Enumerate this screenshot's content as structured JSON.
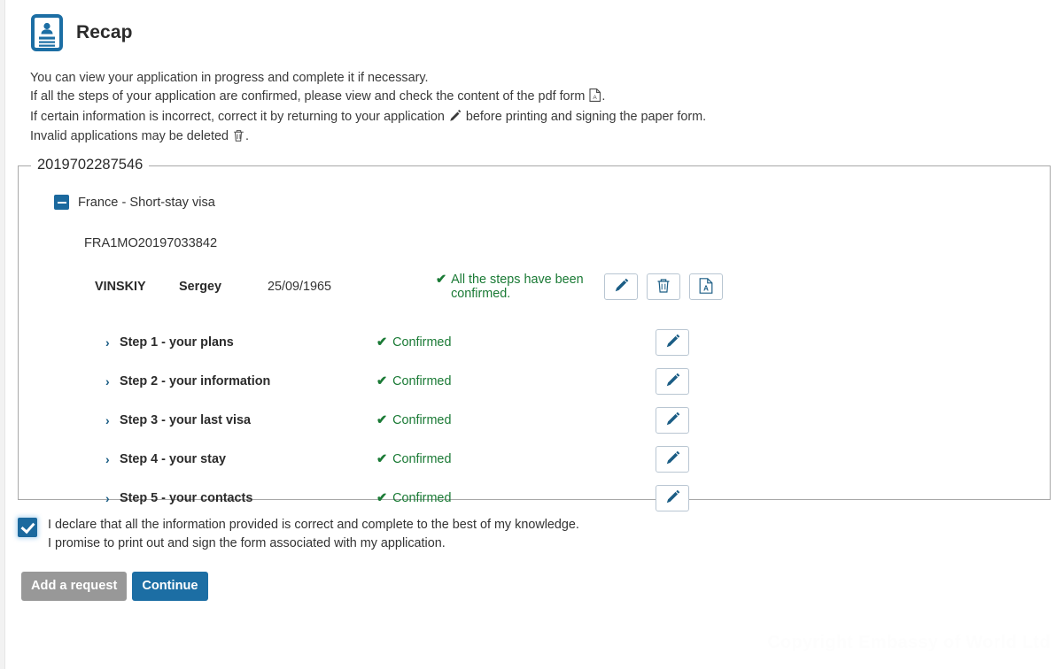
{
  "header": {
    "title": "Recap",
    "icon": "id-card-icon"
  },
  "intro": {
    "line1": "You can view your application in progress and complete it if necessary.",
    "line2_before": "If all the steps of your application are confirmed, please view and check the content of the pdf form",
    "line2_icon": "pdf-icon",
    "line2_after": ".",
    "line3_before": "If certain information is incorrect, correct it by returning to your application",
    "line3_icon": "pencil-icon",
    "line3_after": "before printing and signing the paper form.",
    "line4_before": "Invalid applications may be deleted",
    "line4_icon": "trash-icon",
    "line4_after": "."
  },
  "application": {
    "legend": "2019702287546",
    "toggle_icon": "minus-square-icon",
    "visa_label": "France - Short-stay visa",
    "reference": "FRA1MO20197033842",
    "applicant": {
      "surname": "VINSKIY",
      "firstname": "Sergey",
      "date_of_birth": "25/09/1965",
      "status": "All the steps have been confirmed.",
      "status_check": "✔",
      "actions": [
        {
          "name": "edit-application-button",
          "icon": "pencil-icon"
        },
        {
          "name": "delete-application-button",
          "icon": "trash-icon"
        },
        {
          "name": "download-pdf-button",
          "icon": "pdf-icon"
        }
      ]
    },
    "steps": [
      {
        "label": "Step 1 - your plans",
        "status": "Confirmed",
        "check": "✔",
        "chevron": "›",
        "edit_icon": "pencil-icon"
      },
      {
        "label": "Step 2 - your information",
        "status": "Confirmed",
        "check": "✔",
        "chevron": "›",
        "edit_icon": "pencil-icon"
      },
      {
        "label": "Step 3 - your last visa",
        "status": "Confirmed",
        "check": "✔",
        "chevron": "›",
        "edit_icon": "pencil-icon"
      },
      {
        "label": "Step 4 - your stay",
        "status": "Confirmed",
        "check": "✔",
        "chevron": "›",
        "edit_icon": "pencil-icon"
      },
      {
        "label": "Step 5 - your contacts",
        "status": "Confirmed",
        "check": "✔",
        "chevron": "›",
        "edit_icon": "pencil-icon"
      }
    ]
  },
  "declaration": {
    "checked": true,
    "line1": "I declare that all the information provided is correct and complete to the best of my knowledge.",
    "line2": "I promise to print out and sign the form associated with my application."
  },
  "footer": {
    "add_request_label": "Add a request",
    "continue_label": "Continue"
  },
  "watermark": {
    "text": "Copyright Embassy of World Ltd"
  },
  "colors": {
    "brand_blue": "#1b699e",
    "primary_button": "#1c6ea4",
    "secondary_button": "#989898",
    "confirmed_green": "#1a7a35",
    "icon_blue": "#1b5d85",
    "border_gray": "#a8a8a8"
  }
}
